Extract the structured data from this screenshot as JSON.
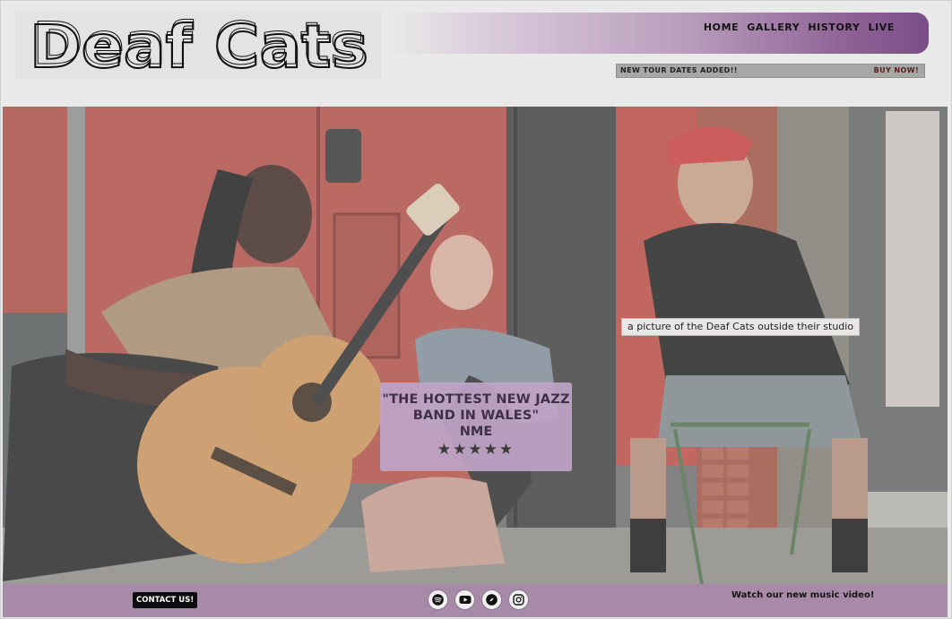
{
  "brand": {
    "name": "Deaf Cats"
  },
  "nav": {
    "items": [
      "HOME",
      "GALLERY",
      "HISTORY",
      "LIVE"
    ]
  },
  "ticker": {
    "message": "NEW TOUR DATES ADDED!!",
    "cta": "BUY NOW!"
  },
  "hero": {
    "image_caption": "a picture of the Deaf Cats outside their studio",
    "quote": "\"THE HOTTEST NEW JAZZ BAND IN WALES\"",
    "quote_source": "NME",
    "rating": "★★★★★"
  },
  "footer": {
    "contact_label": "CONTACT US!",
    "social_icons": [
      "spotify-icon",
      "youtube-icon",
      "compass-icon",
      "instagram-icon"
    ],
    "video_link": "Watch our new music video!"
  },
  "colors": {
    "accent": "#a78aa8",
    "quote_card": "#bfa4c6",
    "nav_gradient_end": "#7b4c86",
    "ticker_bg": "#a5a8a6"
  }
}
